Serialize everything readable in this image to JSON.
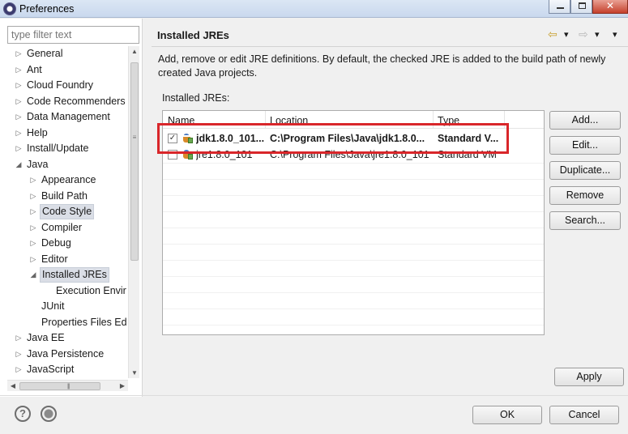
{
  "window": {
    "title": "Preferences"
  },
  "sidebar": {
    "filter_placeholder": "type filter text",
    "items": [
      {
        "label": "General",
        "twisty": "▷"
      },
      {
        "label": "Ant",
        "twisty": "▷"
      },
      {
        "label": "Cloud Foundry",
        "twisty": "▷"
      },
      {
        "label": "Code Recommenders",
        "twisty": "▷"
      },
      {
        "label": "Data Management",
        "twisty": "▷"
      },
      {
        "label": "Help",
        "twisty": "▷"
      },
      {
        "label": "Install/Update",
        "twisty": "▷"
      },
      {
        "label": "Java",
        "twisty": "◢"
      },
      {
        "label": "Appearance",
        "twisty": "▷"
      },
      {
        "label": "Build Path",
        "twisty": "▷"
      },
      {
        "label": "Code Style",
        "twisty": "▷"
      },
      {
        "label": "Compiler",
        "twisty": "▷"
      },
      {
        "label": "Debug",
        "twisty": "▷"
      },
      {
        "label": "Editor",
        "twisty": "▷"
      },
      {
        "label": "Installed JREs",
        "twisty": "◢"
      },
      {
        "label": "Execution Envir",
        "twisty": ""
      },
      {
        "label": "JUnit",
        "twisty": ""
      },
      {
        "label": "Properties Files Ed",
        "twisty": ""
      },
      {
        "label": "Java EE",
        "twisty": "▷"
      },
      {
        "label": "Java Persistence",
        "twisty": "▷"
      },
      {
        "label": "JavaScript",
        "twisty": "▷"
      }
    ]
  },
  "page": {
    "title": "Installed JREs",
    "description": "Add, remove or edit JRE definitions. By default, the checked JRE is added to the build path of newly created Java projects.",
    "table_label": "Installed JREs:",
    "columns": [
      "Name",
      "Location",
      "Type"
    ],
    "rows": [
      {
        "checked": true,
        "name": "jdk1.8.0_101...",
        "location": "C:\\Program Files\\Java\\jdk1.8.0...",
        "type": "Standard V..."
      },
      {
        "checked": false,
        "name": "jre1.8.0_101",
        "location": "C:\\Program Files\\Java\\jre1.8.0_101",
        "type": "Standard VM"
      }
    ]
  },
  "buttons": {
    "add": "Add...",
    "edit": "Edit...",
    "duplicate": "Duplicate...",
    "remove": "Remove",
    "search": "Search...",
    "apply": "Apply",
    "ok": "OK",
    "cancel": "Cancel"
  },
  "nav": {
    "back": "⇦",
    "back_menu": "▾",
    "forward": "⇨",
    "forward_menu": "▾",
    "view_menu": "▾"
  },
  "icons": {
    "help": "?",
    "highlight_color": "#d9262a"
  }
}
